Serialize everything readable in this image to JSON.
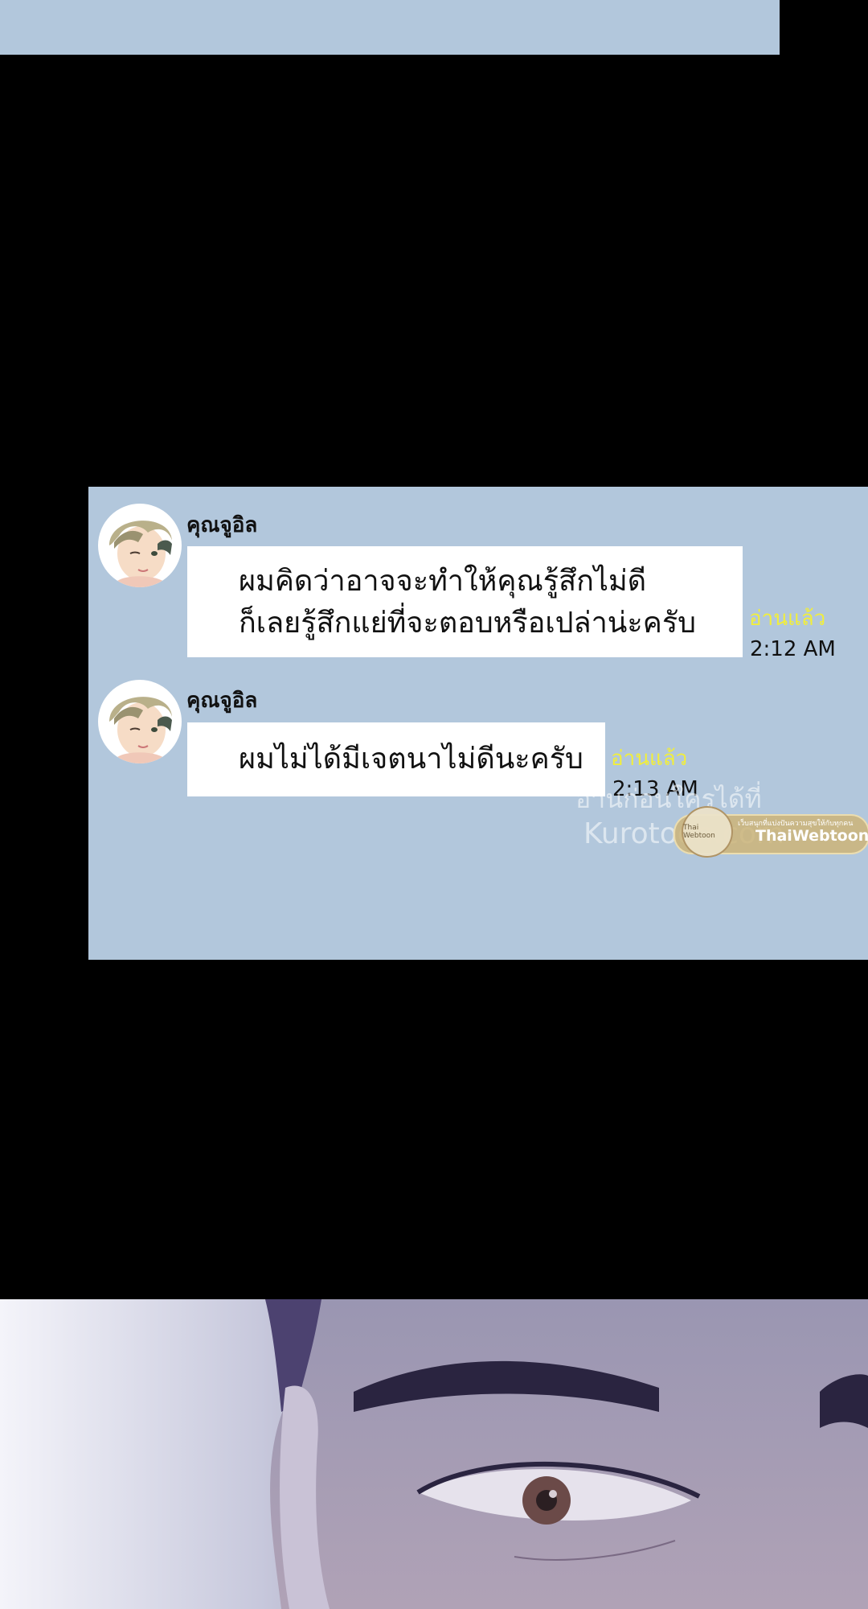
{
  "messages": [
    {
      "sender": "คุณจูอิล",
      "lines": [
        "ผมคิดว่าอาจจะทำให้คุณรู้สึกไม่ดี",
        "ก็เลยรู้สึกแย่ที่จะตอบหรือเปล่าน่ะครับ"
      ],
      "read_status": "อ่านแล้ว",
      "time": "2:12 AM"
    },
    {
      "sender": "คุณจูอิล",
      "lines": [
        "ผมไม่ได้มีเจตนาไม่ดีนะครับ"
      ],
      "read_status": "อ่านแล้ว",
      "time": "2:13 AM"
    }
  ],
  "watermark": {
    "line1": "อ่านก่อนใครได้ที่",
    "line2": "Kurotoon.com",
    "badge_small": "เว็บสนุกที่แบ่งปันความสุขให้กับทุกคน",
    "badge_circle": "Thai Webtoon",
    "badge_brand": "ThaiWebtoon"
  },
  "colors": {
    "chat_background": "#b2c7dc",
    "bubble": "#ffffff",
    "read_status": "#f1ee3c",
    "page_background": "#000000"
  }
}
